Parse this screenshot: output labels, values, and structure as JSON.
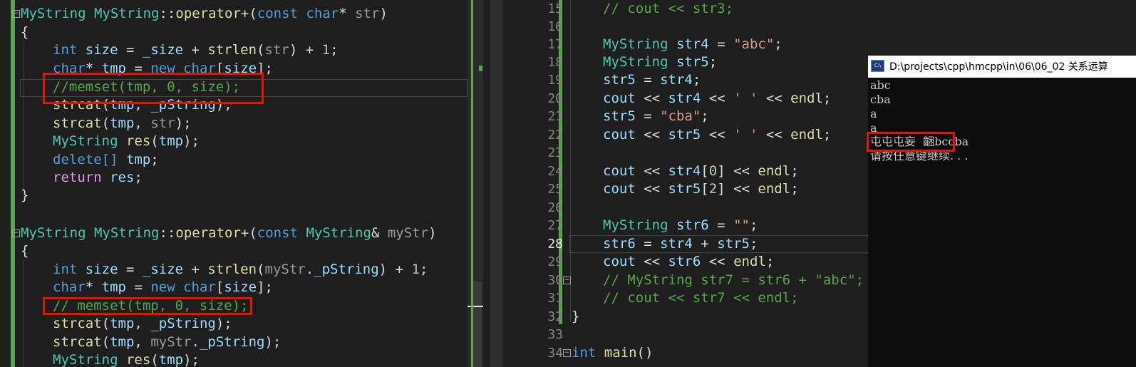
{
  "left_editor": {
    "func1": {
      "sig_type": "MyString",
      "sig_class": "MyString",
      "sig_scope": "::",
      "sig_op": "operator+",
      "sig_open": "(",
      "sig_const": "const",
      "sig_char": "char",
      "sig_star": "*",
      "sig_param": "str",
      "sig_close": ")",
      "brace_open": "{",
      "l1": {
        "kw": "int",
        "var": "size",
        "eq": " = ",
        "mem": "_size",
        "plus": " + ",
        "fn": "strlen",
        "open": "(",
        "arg": "str",
        "close": ")",
        "tail": " + ",
        "num": "1",
        "semi": ";"
      },
      "l2": {
        "kw": "char",
        "star": "*",
        "var": "tmp",
        "eq": " = ",
        "new": "new",
        "kw2": "char",
        "open": "[",
        "arg": "size",
        "close": "];"
      },
      "l3": "//memset(tmp, 0, size);",
      "l4": {
        "fn": "strcat",
        "open": "(",
        "a1": "tmp",
        "comma": ", ",
        "a2": "_pString",
        "close": ");"
      },
      "l5": {
        "fn": "strcat",
        "open": "(",
        "a1": "tmp",
        "comma": ", ",
        "a2": "str",
        "close": ");"
      },
      "l6": {
        "ty": "MyString",
        "fn": "res",
        "open": "(",
        "arg": "tmp",
        "close": ");"
      },
      "l7": {
        "kw": "delete[]",
        "arg": "tmp",
        "semi": ";"
      },
      "l8": {
        "kw": "return",
        "arg": "res",
        "semi": ";"
      },
      "brace_close": "}"
    },
    "func2": {
      "sig_type": "MyString",
      "sig_class": "MyString",
      "sig_scope": "::",
      "sig_op": "operator+",
      "sig_open": "(",
      "sig_const": "const",
      "sig_ptype": "MyString",
      "sig_amp": "&",
      "sig_param": "myStr",
      "sig_close": ")",
      "brace_open": "{",
      "l1": {
        "kw": "int",
        "var": "size",
        "eq": " = ",
        "mem": "_size",
        "plus": " + ",
        "fn": "strlen",
        "open": "(",
        "arg": "myStr",
        "dot": ".",
        "mem2": "_pString",
        "close": ")",
        "tail": " + ",
        "num": "1",
        "semi": ";"
      },
      "l2": {
        "kw": "char",
        "star": "*",
        "var": "tmp",
        "eq": " = ",
        "new": "new",
        "kw2": "char",
        "open": "[",
        "arg": "size",
        "close": "];"
      },
      "l3": "// memset(tmp, 0, size);",
      "l4": {
        "fn": "strcat",
        "open": "(",
        "a1": "tmp",
        "comma": ", ",
        "a2": "_pString",
        "close": ");"
      },
      "l5": {
        "fn": "strcat",
        "open": "(",
        "a1": "tmp",
        "comma": ", ",
        "a2": "myStr",
        "dot": ".",
        "a3": "_pString",
        "close": ");"
      },
      "l6": {
        "ty": "MyString",
        "fn": "res",
        "open": "(",
        "arg": "tmp",
        "close": ");"
      }
    }
  },
  "right_editor": {
    "lines": {
      "n15": "15",
      "n16": "16",
      "n17": "17",
      "n18": "18",
      "n19": "19",
      "n20": "20",
      "n21": "21",
      "n22": "22",
      "n23": "23",
      "n24": "24",
      "n25": "25",
      "n26": "26",
      "n27": "27",
      "n28": "28",
      "n29": "29",
      "n30": "30",
      "n31": "31",
      "n32": "32",
      "n33": "33",
      "n34": "34"
    },
    "c15": "// cout << str3;",
    "c17": {
      "ty": "MyString",
      "var": "str4",
      "eq": " = ",
      "str": "\"abc\"",
      "semi": ";"
    },
    "c18": {
      "ty": "MyString",
      "var": "str5",
      "semi": ";"
    },
    "c19": {
      "a": "str5",
      "eq": " = ",
      "b": "str4",
      "semi": ";"
    },
    "c20": {
      "cout": "cout",
      "op1": " << ",
      "a": "str4",
      "op2": " << ",
      "ch": "' '",
      "op3": " << ",
      "endl": "endl",
      "semi": ";"
    },
    "c21": {
      "a": "str5",
      "eq": " = ",
      "str": "\"cba\"",
      "semi": ";"
    },
    "c22": {
      "cout": "cout",
      "op1": " << ",
      "a": "str5",
      "op2": " << ",
      "ch": "' '",
      "op3": " << ",
      "endl": "endl",
      "semi": ";"
    },
    "c24": {
      "cout": "cout",
      "op1": " << ",
      "a": "str4",
      "open": "[",
      "num": "0",
      "close": "]",
      "op2": " << ",
      "endl": "endl",
      "semi": ";"
    },
    "c25": {
      "cout": "cout",
      "op1": " << ",
      "a": "str5",
      "open": "[",
      "num": "2",
      "close": "]",
      "op2": " << ",
      "endl": "endl",
      "semi": ";"
    },
    "c27": {
      "ty": "MyString",
      "var": "str6",
      "eq": " = ",
      "str": "\"\"",
      "semi": ";"
    },
    "c28": {
      "a": "str6",
      "eq": " = ",
      "b": "str4",
      "plus": " + ",
      "c": "str5",
      "semi": ";"
    },
    "c29": {
      "cout": "cout",
      "op1": " << ",
      "a": "str6",
      "op2": " << ",
      "endl": "endl",
      "semi": ";"
    },
    "c30": "// MyString str7 = str6 + \"abc\";",
    "c31": "// cout << str7 << endl;",
    "c32": "}",
    "c34": {
      "kw": "int",
      "fn": "main",
      "paren": "()"
    }
  },
  "console": {
    "title": "D:\\projects\\cpp\\hmcpp\\in\\06\\06_02 关系运算",
    "icon_label": "C:\\",
    "output": [
      "abc",
      "cba",
      "a",
      "a",
      "屯屯屯妄  齫bccba",
      "请按任意键继续. . ."
    ]
  },
  "colors": {
    "background": "#1e1e1e",
    "keyword": "#569cd6",
    "type": "#4ec9b0",
    "function": "#dcdcaa",
    "variable": "#9cdcfe",
    "string": "#d69d85",
    "comment": "#57a64a",
    "control": "#d8a0df",
    "highlight_box": "#e51400",
    "change_bar": "#57a64a"
  }
}
